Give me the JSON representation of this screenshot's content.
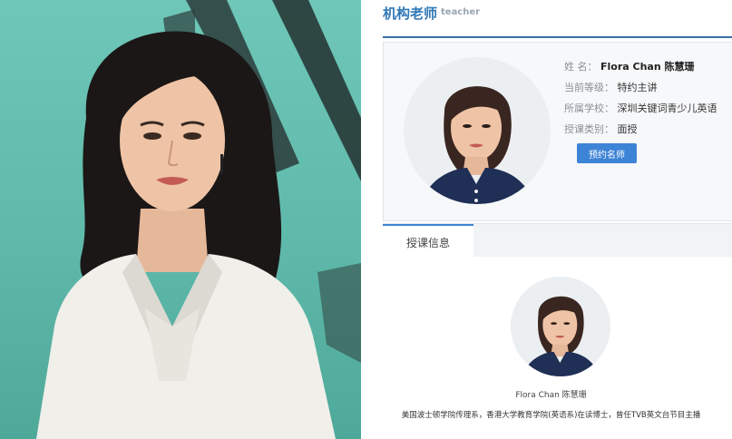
{
  "section": {
    "title": "机构老师",
    "subtitle": "teacher"
  },
  "profile": {
    "name_label": "姓 名：",
    "name_value": "Flora Chan 陈慧珊",
    "grade_label": "当前等级：",
    "grade_value": "特约主讲",
    "school_label": "所属学校：",
    "school_value": "深圳关键词青少儿英语",
    "type_label": "授课类别：",
    "type_value": "面授",
    "book_button": "预约名师"
  },
  "tabs": [
    {
      "label": "授课信息",
      "active": true
    }
  ],
  "detail": {
    "caption_name": "Flora Chan 陈慧珊",
    "bio": "美国波士顿学院传理系，香港大学教育学院(英语系)在读博士，曾任TVB英文台节目主播"
  },
  "colors": {
    "accent": "#2f78b7",
    "button": "#3e84d6",
    "photo_bg": "#5fb9aa",
    "jacket": "#f1efea",
    "shirt_navy": "#1f2f55"
  }
}
